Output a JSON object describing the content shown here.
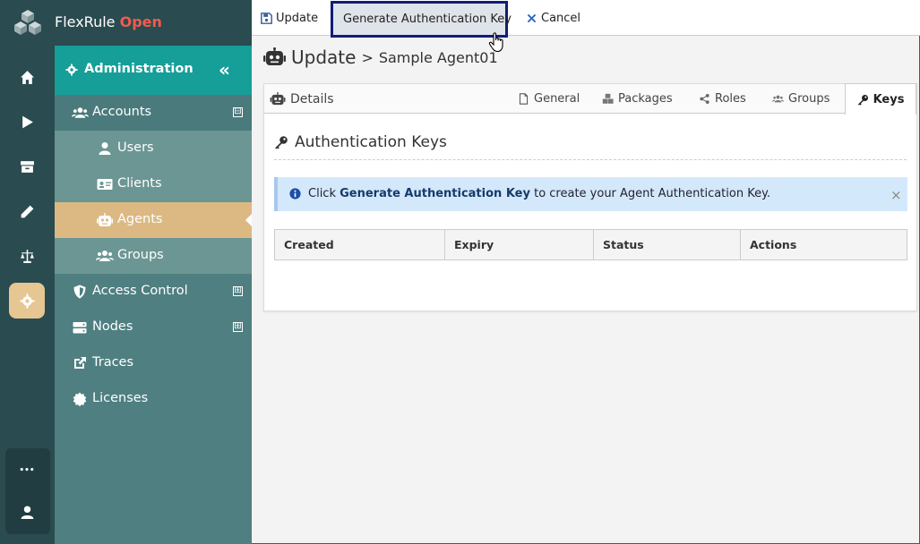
{
  "brand": {
    "name": "FlexRule",
    "edition": "Open"
  },
  "nav": {
    "admin_label": "Administration",
    "collapse_glyph": "«",
    "items": [
      {
        "label": "Accounts",
        "toggle": "⊟"
      },
      {
        "label": "Users"
      },
      {
        "label": "Clients"
      },
      {
        "label": "Agents"
      },
      {
        "label": "Groups"
      },
      {
        "label": "Access Control",
        "toggle": "⊞"
      },
      {
        "label": "Nodes",
        "toggle": "⊞"
      },
      {
        "label": "Traces"
      },
      {
        "label": "Licenses"
      }
    ]
  },
  "rail": {
    "icons": [
      "home-icon",
      "play-icon",
      "archive-icon",
      "pencil-icon",
      "scale-icon",
      "gear-icon",
      "more-icon",
      "user-icon"
    ],
    "more_glyph": "•••"
  },
  "toolbar": {
    "update_label": "Update",
    "generate_label": "Generate Authentication Key",
    "cancel_label": "Cancel"
  },
  "page": {
    "action": "Update",
    "separator": ">",
    "name": "Sample Agent01"
  },
  "tabs": {
    "details": "Details",
    "general": "General",
    "packages": "Packages",
    "roles": "Roles",
    "groups": "Groups",
    "keys": "Keys"
  },
  "section": {
    "title": "Authentication Keys",
    "info_prefix": "Click",
    "info_bold": "Generate Authentication Key",
    "info_suffix": "to create your Agent Authentication Key.",
    "close_glyph": "×"
  },
  "table": {
    "columns": [
      "Created",
      "Expiry",
      "Status",
      "Actions"
    ]
  },
  "colors": {
    "rail": "#2a4b50",
    "admin_header": "#169e99",
    "active_item": "#dcb983",
    "brand_open": "#f25b4e",
    "info_bg": "#d4e8fb"
  }
}
